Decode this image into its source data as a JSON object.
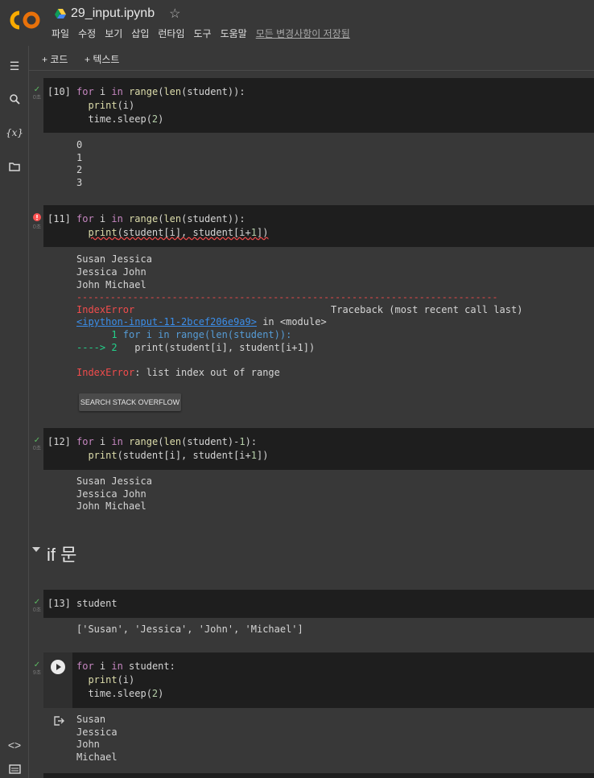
{
  "header": {
    "title": "29_input.ipynb",
    "menu": [
      "파일",
      "수정",
      "보기",
      "삽입",
      "런타임",
      "도구",
      "도움말"
    ],
    "saved_status": "모든 변경사항이 저장됨"
  },
  "toolbar": {
    "add_code": "+ 코드",
    "add_text": "+ 텍스트"
  },
  "rail_icons": [
    "toc-icon",
    "search-icon",
    "variables-icon",
    "folder-icon",
    "code-snippets-icon",
    "terminal-icon"
  ],
  "cells": {
    "c10": {
      "count": "[10]",
      "status": "0초",
      "code": [
        "for i in range(len(student)):",
        "  print(i)",
        "  time.sleep(2)"
      ],
      "output": [
        "0",
        "1",
        "2",
        "3"
      ]
    },
    "c11": {
      "count": "[11]",
      "status": "0초",
      "code": [
        "for i in range(len(student)):",
        "  print(student[i], student[i+1])"
      ],
      "output": [
        "Susan Jessica",
        "Jessica John",
        "John Michael"
      ],
      "error_rule": "---------------------------------------------------------------------------",
      "error_name": "IndexError",
      "traceback_label": "Traceback (most recent call last)",
      "input_link": "<ipython-input-11-2bcef206e9a9>",
      "in_module": " in <module>",
      "tb_line1_no": "      1 ",
      "tb_line1_code": "for i in range(len(student)):",
      "tb_arrow": "----> 2 ",
      "tb_line2_code": "  print(student[i], student[i+1])",
      "error_message": ": list index out of range",
      "so_button": "SEARCH STACK OVERFLOW"
    },
    "c12": {
      "count": "[12]",
      "status": "0초",
      "code": [
        "for i in range(len(student)-1):",
        "  print(student[i], student[i+1])"
      ],
      "output": [
        "Susan Jessica",
        "Jessica John",
        "John Michael"
      ]
    },
    "heading": "if 문",
    "c13": {
      "count": "[13]",
      "status": "0초",
      "code": [
        "student"
      ],
      "output": [
        "['Susan', 'Jessica', 'John', 'Michael']"
      ]
    },
    "c14": {
      "status": "9초",
      "code": [
        "for i in student:",
        "  print(i)",
        "  time.sleep(2)"
      ],
      "output": [
        "Susan",
        "Jessica",
        "John",
        "Michael"
      ]
    }
  }
}
